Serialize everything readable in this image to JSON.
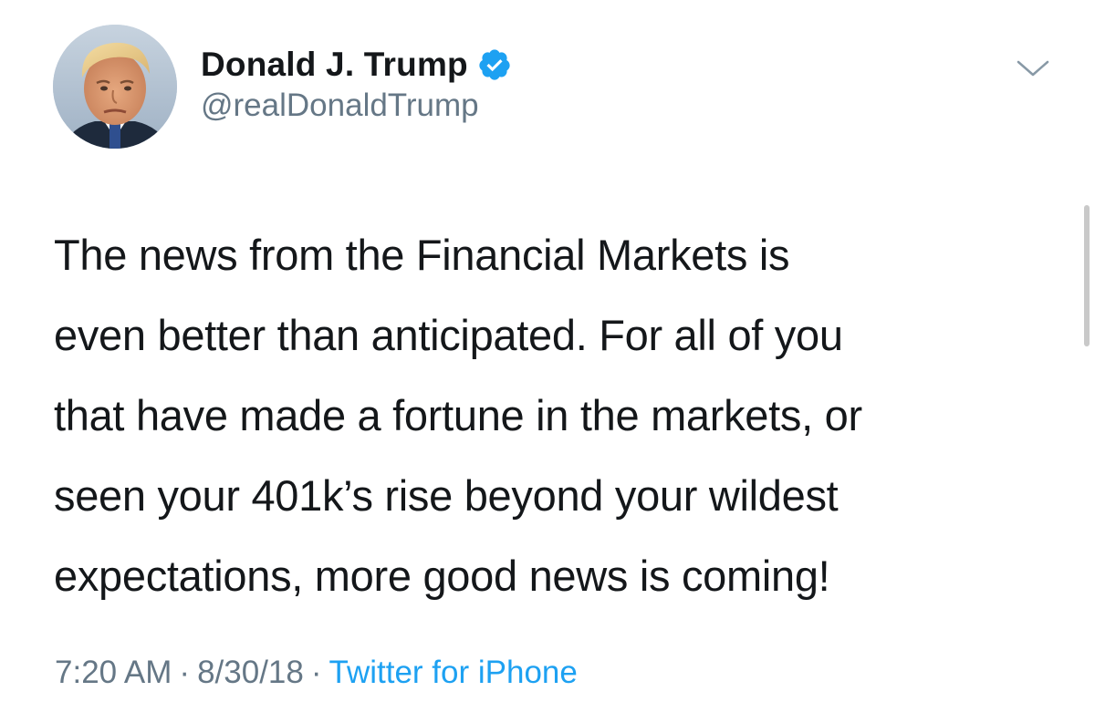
{
  "author": {
    "display_name": "Donald J. Trump",
    "handle": "@realDonaldTrump",
    "verified": true,
    "verified_icon": "verified-badge-icon",
    "avatar_icon": "profile-photo"
  },
  "tweet": {
    "lines": [
      "The news from the Financial Markets is",
      "even better than anticipated. For all of you",
      "that have made a fortune in the markets, or",
      "seen your 401k’s rise beyond your wildest",
      "expectations, more good news is coming!"
    ]
  },
  "meta": {
    "time": "7:20 AM",
    "separator": "·",
    "date": "8/30/18",
    "source": "Twitter for iPhone"
  },
  "controls": {
    "menu_icon": "chevron-down-icon"
  },
  "colors": {
    "text_primary": "#14171a",
    "text_secondary": "#657786",
    "accent": "#1da1f2"
  }
}
